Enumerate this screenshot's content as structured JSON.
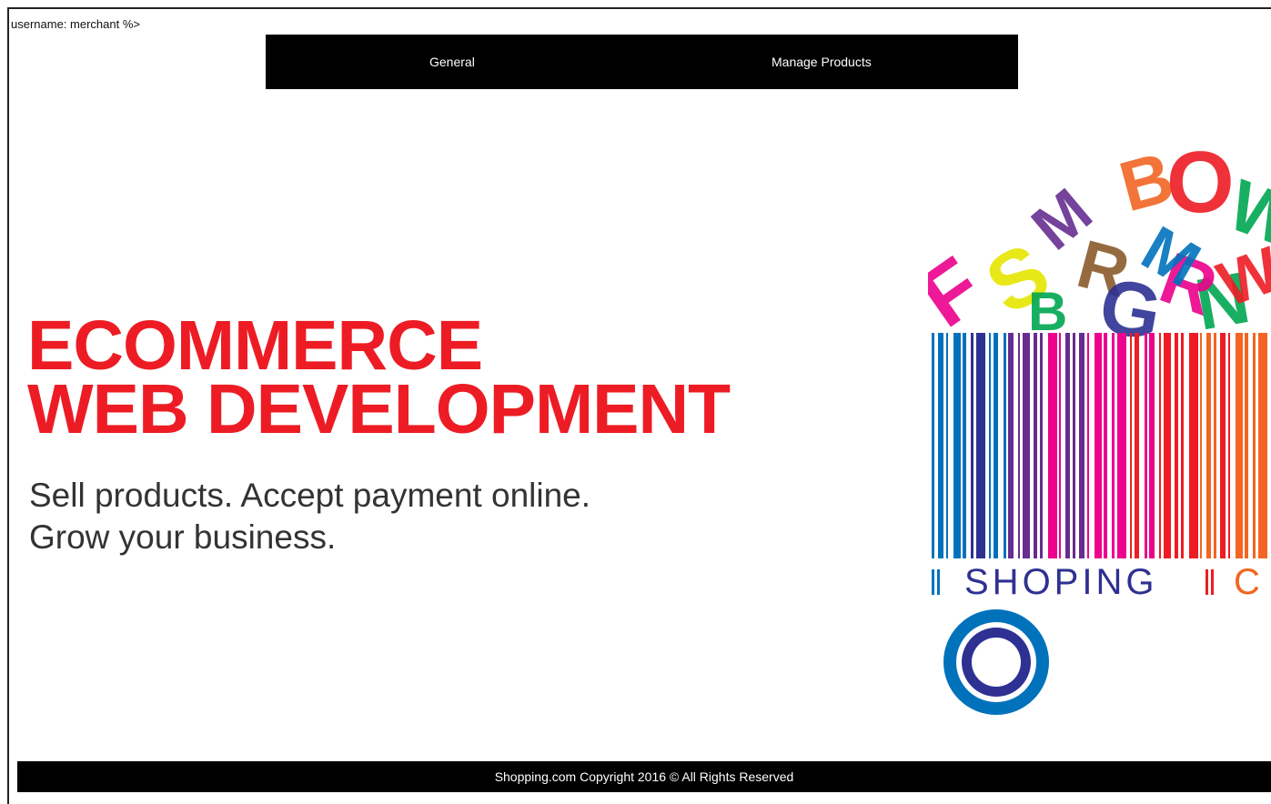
{
  "user": {
    "label": "username: merchant %>"
  },
  "nav": {
    "items": [
      {
        "label": "General"
      },
      {
        "label": "Manage Products"
      }
    ]
  },
  "hero": {
    "headline_line1": "ECOMMERCE",
    "headline_line2": "WEB DEVELOPMENT",
    "tagline_line1": "Sell products. Accept payment online.",
    "tagline_line2": "Grow your business."
  },
  "banner": {
    "letters": [
      "B",
      "O",
      "W",
      "M",
      "S",
      "R",
      "F",
      "G",
      "N"
    ],
    "caption": "SHOPING",
    "caption_partial": "C",
    "colors": {
      "red": "#ed1c24",
      "orange": "#f26522",
      "purple": "#662d91",
      "magenta": "#ec008c",
      "blue": "#0072bc",
      "green": "#00a651",
      "yellow": "#e6e600",
      "brown": "#8b5a2b",
      "navy": "#2e3192"
    }
  },
  "footer": {
    "text": "Shopping.com Copyright 2016 © All Rights Reserved"
  }
}
